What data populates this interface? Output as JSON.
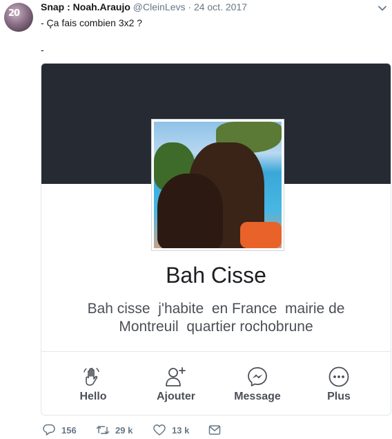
{
  "tweet": {
    "author_name": "Snap : Noah.Araujo",
    "handle": "@CleinLevs",
    "separator": "·",
    "date": "24 oct. 2017",
    "avatar_text": "20",
    "text_line1": "- Ça fais combien 3x2 ?",
    "text_line2": "-"
  },
  "card": {
    "name": "Bah Cisse",
    "bio": "Bah cisse  j'habite  en France  mairie de\nMontreuil  quartier rochobrune",
    "actions": [
      {
        "label": "Hello",
        "icon": "wave-hand-icon"
      },
      {
        "label": "Ajouter",
        "icon": "add-friend-icon"
      },
      {
        "label": "Message",
        "icon": "messenger-icon"
      },
      {
        "label": "Plus",
        "icon": "more-dots-icon"
      }
    ]
  },
  "footer": {
    "replies": "156",
    "retweets": "29 k",
    "likes": "13 k"
  },
  "colors": {
    "cover": "#252a33",
    "text_muted": "#657786",
    "action_text": "#4b4f56"
  }
}
